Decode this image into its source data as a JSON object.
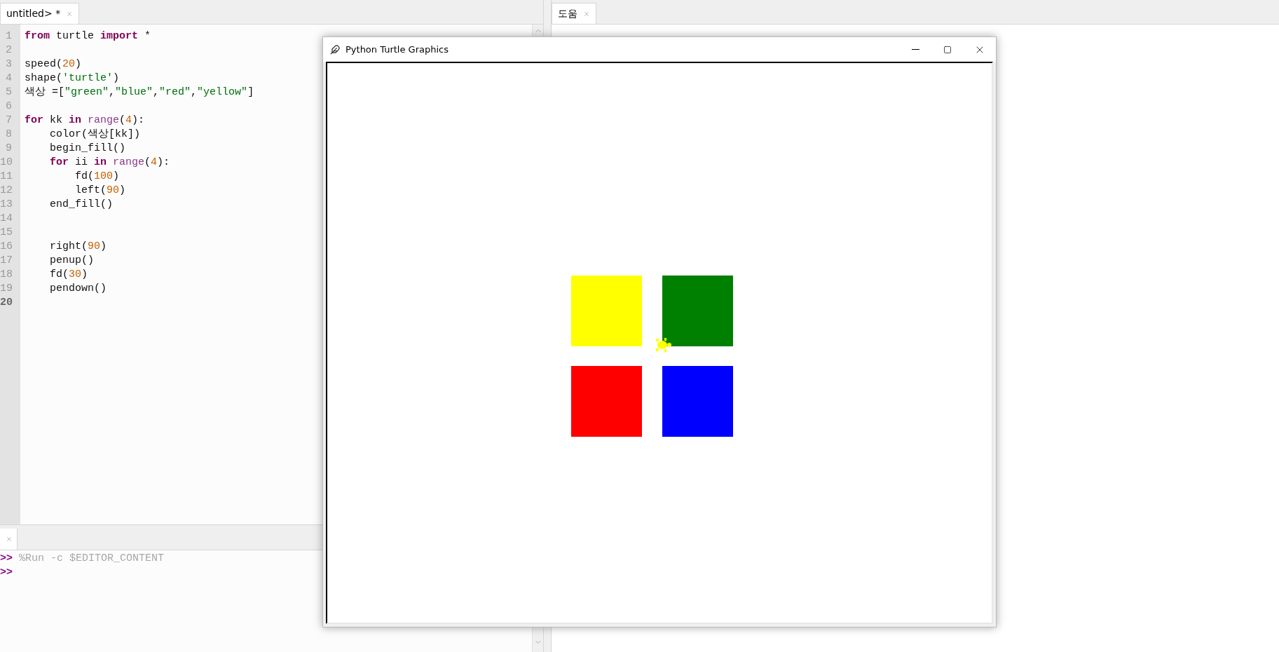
{
  "editor": {
    "tab": {
      "title": "untitled> *",
      "selected": true
    },
    "lines": [
      {
        "number": "1",
        "current": false,
        "tokens": [
          {
            "text": "from",
            "kind": "keyword"
          },
          {
            "text": " turtle ",
            "kind": "plain"
          },
          {
            "text": "import",
            "kind": "keyword"
          },
          {
            "text": " *",
            "kind": "plain"
          }
        ]
      },
      {
        "number": "2",
        "current": false
      },
      {
        "number": "3",
        "current": false,
        "tokens": [
          {
            "text": "speed(",
            "kind": "plain"
          },
          {
            "text": "20",
            "kind": "number"
          },
          {
            "text": ")",
            "kind": "plain"
          }
        ]
      },
      {
        "number": "4",
        "current": false,
        "tokens": [
          {
            "text": "shape(",
            "kind": "plain"
          },
          {
            "text": "'turtle'",
            "kind": "string"
          },
          {
            "text": ")",
            "kind": "plain"
          }
        ]
      },
      {
        "number": "5",
        "current": false,
        "tokens": [
          {
            "text": "색상 =[",
            "kind": "plain"
          },
          {
            "text": "\"green\"",
            "kind": "string"
          },
          {
            "text": ",",
            "kind": "plain"
          },
          {
            "text": "\"blue\"",
            "kind": "string"
          },
          {
            "text": ",",
            "kind": "plain"
          },
          {
            "text": "\"red\"",
            "kind": "string"
          },
          {
            "text": ",",
            "kind": "plain"
          },
          {
            "text": "\"yellow\"",
            "kind": "string"
          },
          {
            "text": "]",
            "kind": "plain"
          }
        ]
      },
      {
        "number": "6",
        "current": false
      },
      {
        "number": "7",
        "current": false,
        "tokens": [
          {
            "text": "for",
            "kind": "keyword"
          },
          {
            "text": " kk ",
            "kind": "plain"
          },
          {
            "text": "in ",
            "kind": "keyword"
          },
          {
            "text": "range",
            "kind": "builtin"
          },
          {
            "text": "(",
            "kind": "plain"
          },
          {
            "text": "4",
            "kind": "number"
          },
          {
            "text": "):",
            "kind": "plain"
          }
        ]
      },
      {
        "number": "8",
        "current": false,
        "tokens": [
          {
            "text": "    color(색상[kk])",
            "kind": "plain"
          }
        ]
      },
      {
        "number": "9",
        "current": false,
        "tokens": [
          {
            "text": "    begin_fill()",
            "kind": "plain"
          }
        ]
      },
      {
        "number": "10",
        "current": false,
        "tokens": [
          {
            "text": "    for",
            "kind": "keyword"
          },
          {
            "text": " ii ",
            "kind": "plain"
          },
          {
            "text": "in ",
            "kind": "keyword"
          },
          {
            "text": "range",
            "kind": "builtin"
          },
          {
            "text": "(",
            "kind": "plain"
          },
          {
            "text": "4",
            "kind": "number"
          },
          {
            "text": "):",
            "kind": "plain"
          }
        ]
      },
      {
        "number": "11",
        "current": false,
        "tokens": [
          {
            "text": "        fd(",
            "kind": "plain"
          },
          {
            "text": "100",
            "kind": "number"
          },
          {
            "text": ")",
            "kind": "plain"
          }
        ]
      },
      {
        "number": "12",
        "current": false,
        "tokens": [
          {
            "text": "        left(",
            "kind": "plain"
          },
          {
            "text": "90",
            "kind": "number"
          },
          {
            "text": ")",
            "kind": "plain"
          }
        ]
      },
      {
        "number": "13",
        "current": false,
        "tokens": [
          {
            "text": "    end_fill()",
            "kind": "plain"
          }
        ]
      },
      {
        "number": "14",
        "current": false
      },
      {
        "number": "15",
        "current": false
      },
      {
        "number": "16",
        "current": false,
        "tokens": [
          {
            "text": "    right(",
            "kind": "plain"
          },
          {
            "text": "90",
            "kind": "number"
          },
          {
            "text": ")",
            "kind": "plain"
          }
        ]
      },
      {
        "number": "17",
        "current": false,
        "tokens": [
          {
            "text": "    penup()",
            "kind": "plain"
          }
        ]
      },
      {
        "number": "18",
        "current": false,
        "tokens": [
          {
            "text": "    fd(",
            "kind": "plain"
          },
          {
            "text": "30",
            "kind": "number"
          },
          {
            "text": ")",
            "kind": "plain"
          }
        ]
      },
      {
        "number": "19",
        "current": false,
        "tokens": [
          {
            "text": "    pendown()",
            "kind": "plain"
          }
        ]
      },
      {
        "number": "20",
        "current": true
      }
    ]
  },
  "shell": {
    "lines": [
      {
        "prompt": ">>",
        "command": "%Run -c $EDITOR_CONTENT"
      },
      {
        "prompt": ">>"
      }
    ]
  },
  "help": {
    "tab": {
      "title": "도움",
      "selected": true
    }
  },
  "turtle_window": {
    "title": "Python Turtle Graphics",
    "squares": [
      {
        "color": "#ffff00"
      },
      {
        "color": "#008000"
      },
      {
        "color": "#ff0000"
      },
      {
        "color": "#0000ff"
      }
    ],
    "turtle": {
      "color": "#ffff00"
    }
  }
}
